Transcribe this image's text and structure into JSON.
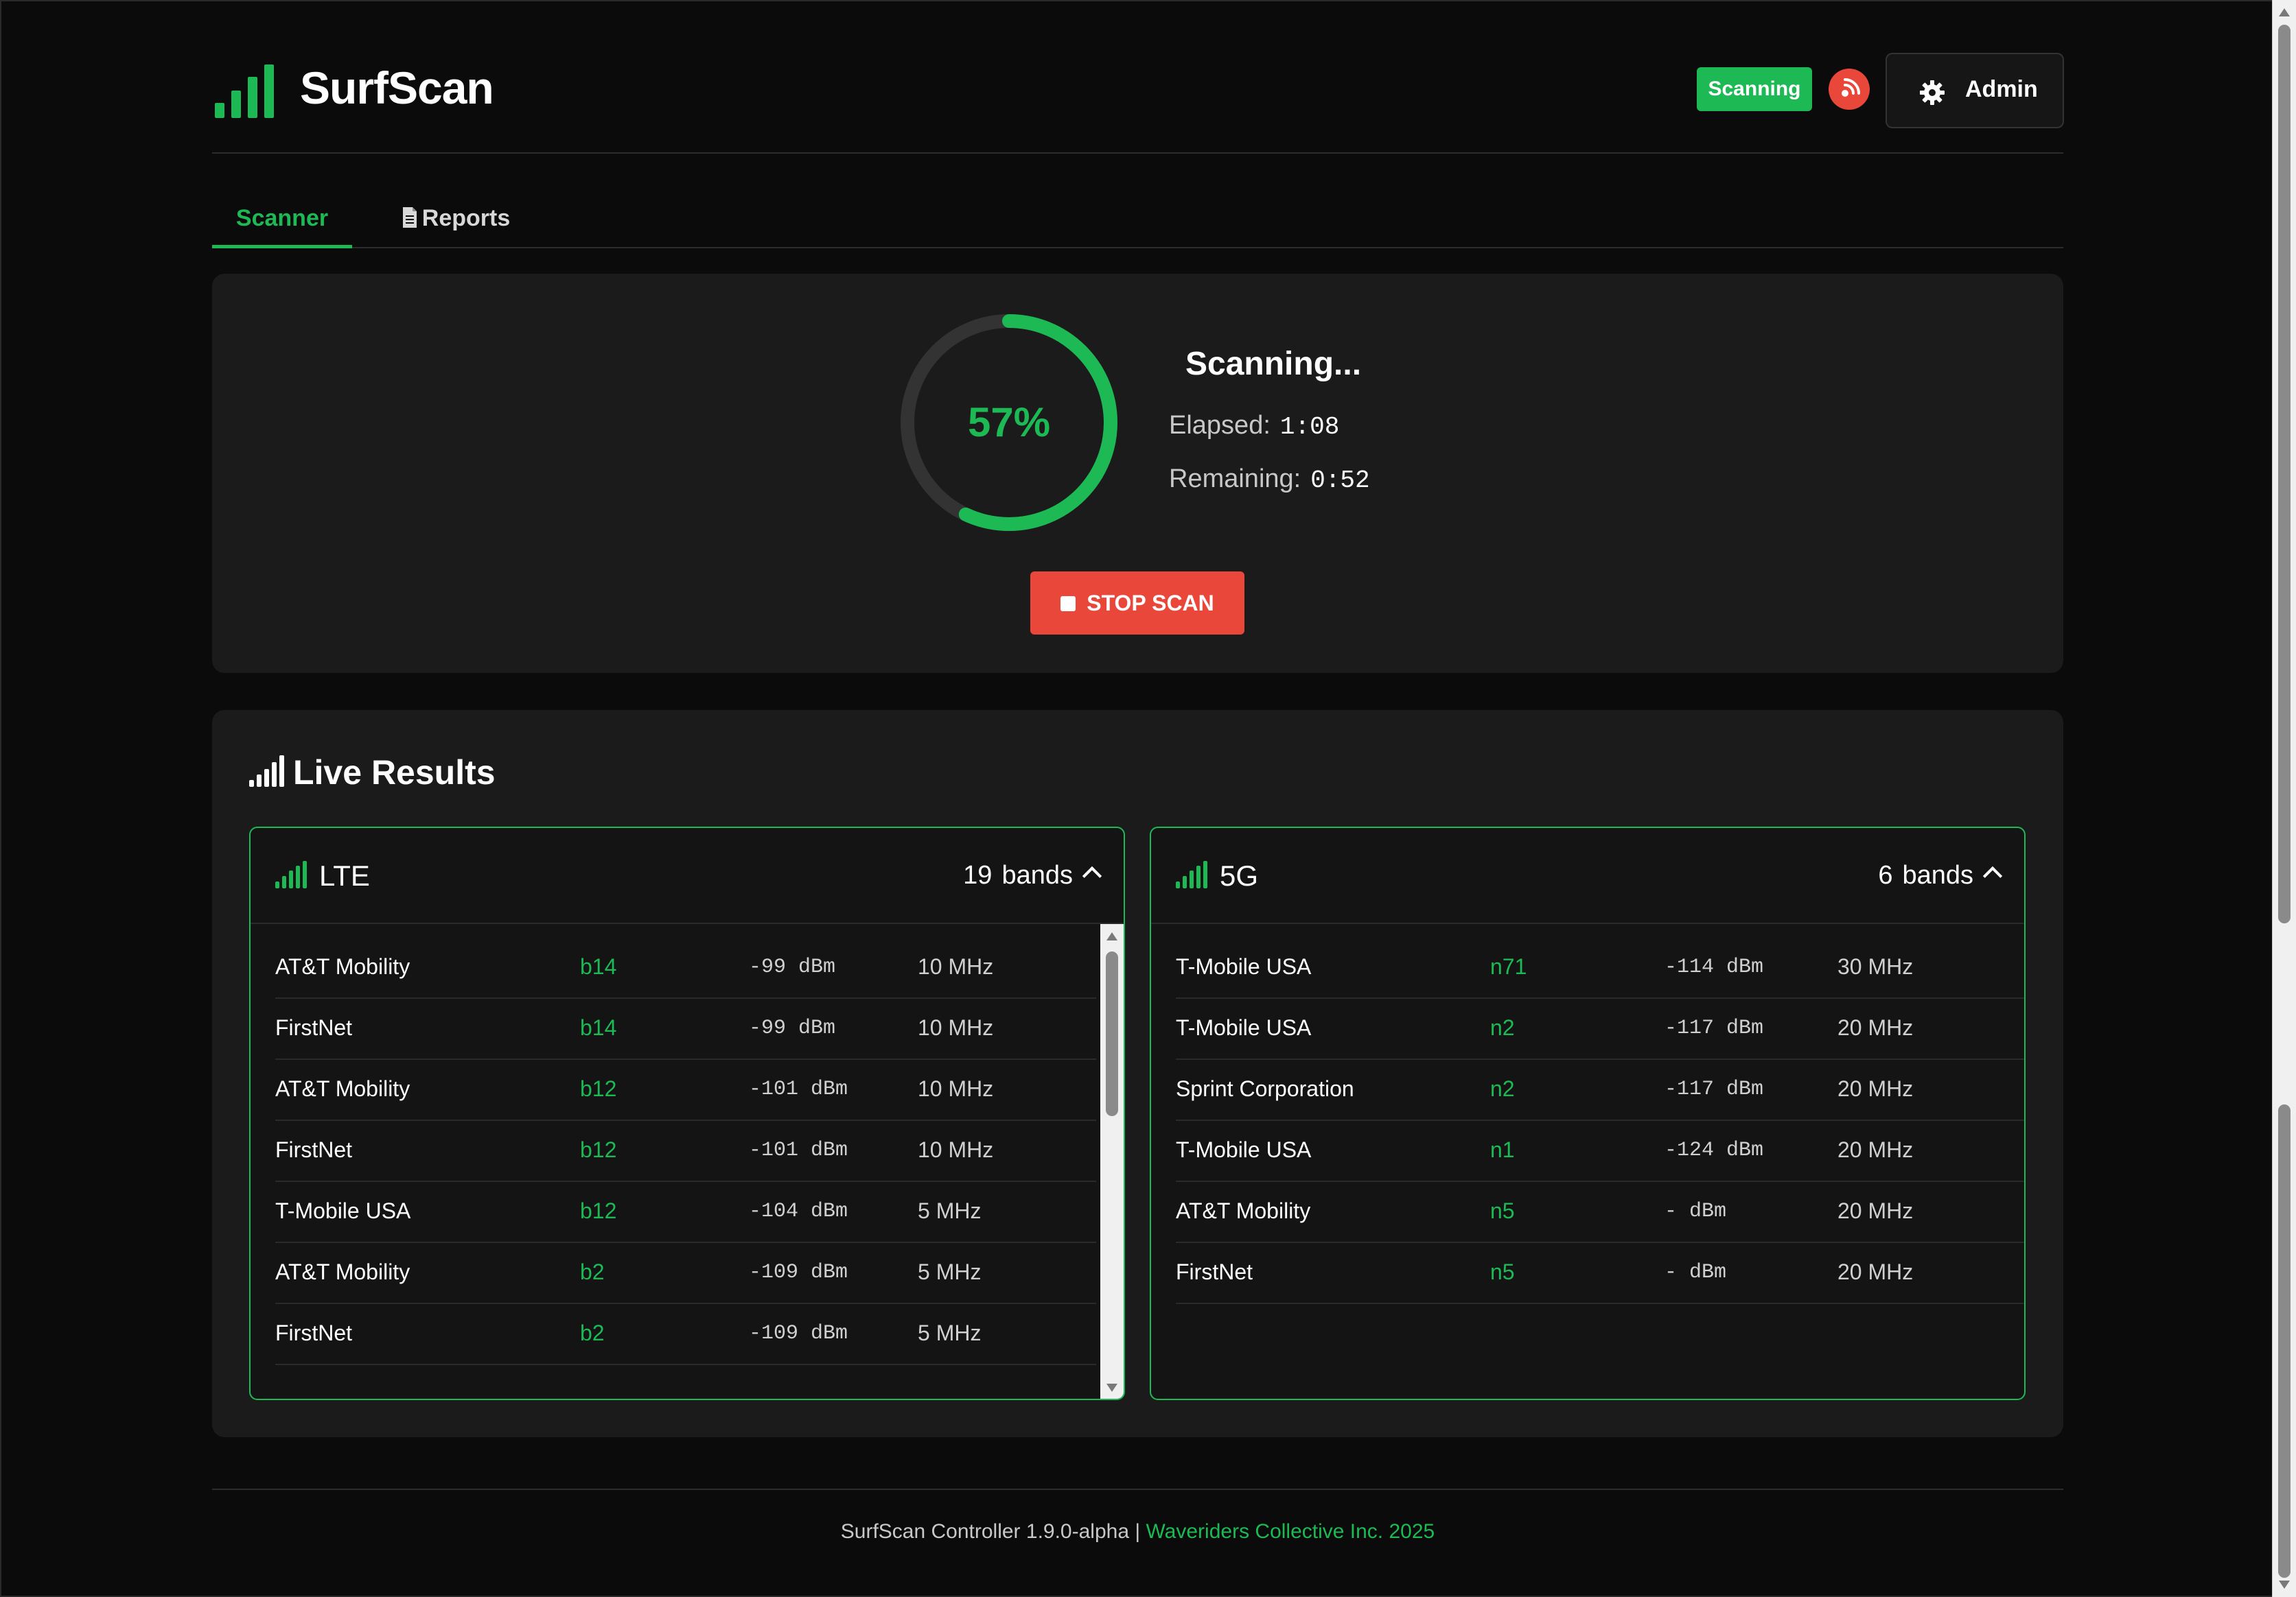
{
  "app": {
    "brand": "SurfScan",
    "status": "Scanning",
    "admin_label": "Admin"
  },
  "tabs": [
    {
      "label": "Scanner",
      "active": true
    },
    {
      "label": "Reports",
      "active": false
    }
  ],
  "scan": {
    "progress_pct": 57,
    "progress_label": "57%",
    "title": "Scanning...",
    "elapsed_label": "Elapsed:",
    "elapsed": "1:08",
    "remaining_label": "Remaining:",
    "remaining": "0:52",
    "stop_label": "STOP SCAN"
  },
  "live": {
    "title": "Live Results",
    "lte": {
      "name": "LTE",
      "count": "19",
      "count_unit": "bands",
      "rows": [
        {
          "carrier": "AT&T Mobility",
          "band": "b14",
          "rssi": "-99 dBm",
          "bw": "10 MHz"
        },
        {
          "carrier": "FirstNet",
          "band": "b14",
          "rssi": "-99 dBm",
          "bw": "10 MHz"
        },
        {
          "carrier": "AT&T Mobility",
          "band": "b12",
          "rssi": "-101 dBm",
          "bw": "10 MHz"
        },
        {
          "carrier": "FirstNet",
          "band": "b12",
          "rssi": "-101 dBm",
          "bw": "10 MHz"
        },
        {
          "carrier": "T-Mobile USA",
          "band": "b12",
          "rssi": "-104 dBm",
          "bw": "5 MHz"
        },
        {
          "carrier": "AT&T Mobility",
          "band": "b2",
          "rssi": "-109 dBm",
          "bw": "5 MHz"
        },
        {
          "carrier": "FirstNet",
          "band": "b2",
          "rssi": "-109 dBm",
          "bw": "5 MHz"
        }
      ]
    },
    "nr": {
      "name": "5G",
      "count": "6",
      "count_unit": "bands",
      "rows": [
        {
          "carrier": "T-Mobile USA",
          "band": "n71",
          "rssi": "-114 dBm",
          "bw": "30 MHz"
        },
        {
          "carrier": "T-Mobile USA",
          "band": "n2",
          "rssi": "-117 dBm",
          "bw": "20 MHz"
        },
        {
          "carrier": "Sprint Corporation",
          "band": "n2",
          "rssi": "-117 dBm",
          "bw": "20 MHz"
        },
        {
          "carrier": "T-Mobile USA",
          "band": "n1",
          "rssi": "-124 dBm",
          "bw": "20 MHz"
        },
        {
          "carrier": "AT&T Mobility",
          "band": "n5",
          "rssi": "- dBm",
          "bw": "20 MHz"
        },
        {
          "carrier": "FirstNet",
          "band": "n5",
          "rssi": "- dBm",
          "bw": "20 MHz"
        }
      ]
    }
  },
  "footer": {
    "text": "SurfScan Controller 1.9.0-alpha |",
    "link": "Waveriders Collective Inc. 2025"
  },
  "colors": {
    "accent": "#1db954",
    "danger": "#e8473a",
    "background": "#0b0b0b",
    "panel": "#1b1b1b"
  },
  "icons": {
    "logo": "signal-bars-icon",
    "broadcast": "broadcast-icon",
    "admin": "gear-icon",
    "reports": "document-icon",
    "stop": "stop-square-icon",
    "collapse": "chevron-up-icon"
  }
}
